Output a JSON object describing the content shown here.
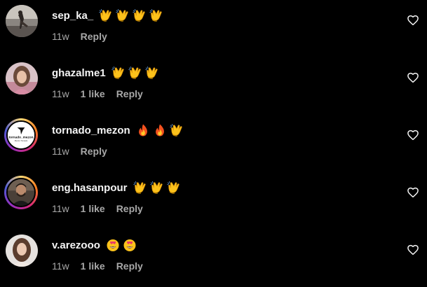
{
  "colors": {
    "background": "#000000",
    "username": "#f5f5f5",
    "meta": "#a8a8a8"
  },
  "comments": [
    {
      "username": "sep_ka_",
      "emojis": [
        "clapping-hands",
        "clapping-hands",
        "clapping-hands",
        "clapping-hands"
      ],
      "time": "11w",
      "likes": "",
      "reply": "Reply",
      "avatar": "photo-silhouette"
    },
    {
      "username": "ghazalme1",
      "emojis": [
        "clapping-hands",
        "clapping-hands",
        "clapping-hands"
      ],
      "time": "11w",
      "likes": "1 like",
      "reply": "Reply",
      "avatar": "photo-woman"
    },
    {
      "username": "tornado_mezon",
      "emojis": [
        "fire",
        "fire",
        "clapping-hands"
      ],
      "time": "11w",
      "likes": "",
      "reply": "Reply",
      "avatar": "logo-tornado",
      "avatar_text": "tornado_mezon",
      "avatar_subtext": "Mezon Tornado"
    },
    {
      "username": "eng.hasanpour",
      "emojis": [
        "clapping-hands",
        "clapping-hands",
        "clapping-hands"
      ],
      "time": "11w",
      "likes": "1 like",
      "reply": "Reply",
      "avatar": "photo-man"
    },
    {
      "username": "v.arezooo",
      "emojis": [
        "smiling-face-with-heart-eyes",
        "smiling-face-with-heart-eyes"
      ],
      "time": "11w",
      "likes": "1 like",
      "reply": "Reply",
      "avatar": "photo-woman-2"
    }
  ]
}
